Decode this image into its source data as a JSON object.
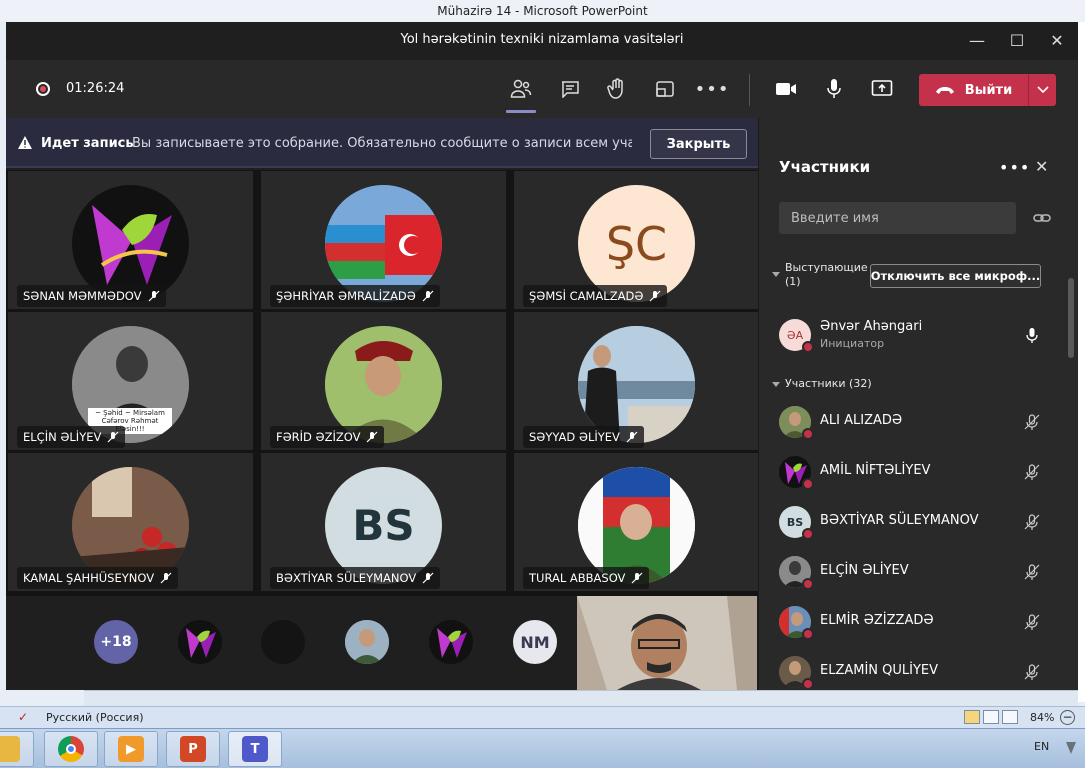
{
  "powerpoint": {
    "title": "Mühazirə 14  -  Microsoft PowerPoint",
    "status_language": "Русский (Россия)",
    "zoom": "84%"
  },
  "taskbar": {
    "language": "EN",
    "apps": [
      "file-explorer-icon",
      "chrome-icon",
      "media-player-icon",
      "powerpoint-icon",
      "teams-icon"
    ]
  },
  "teams": {
    "window_title": "Yol hərəkətinin texniki nizamlama vasitələri",
    "toolbar": {
      "timer": "01:26:24",
      "leave_label": "Выйти"
    },
    "banner": {
      "title": "Идет запись",
      "message": "Вы записываете это собрание. Обязательно сообщите о записи всем участ...",
      "close_label": "Закрыть"
    },
    "tiles": [
      {
        "name": "SƏNAN MƏMMƏDOV",
        "initials": ""
      },
      {
        "name": "ŞƏHRİYAR ƏMRALİZADƏ",
        "initials": ""
      },
      {
        "name": "ŞƏMSİ CAMALZADƏ",
        "initials": "ŞC"
      },
      {
        "name": "ELÇİN ƏLİYEV",
        "initials": "",
        "caption": "~ Şəhid ~ Mirsəlam Cəfərov Rəhmət Eləsin!!!"
      },
      {
        "name": "FƏRİD ƏZİZOV",
        "initials": ""
      },
      {
        "name": "SƏYYAD ƏLİYEV",
        "initials": ""
      },
      {
        "name": "KAMAL ŞAHHÜSEYNOV",
        "initials": ""
      },
      {
        "name": "BƏXTİYAR SÜLEYMANOV",
        "initials": "BS"
      },
      {
        "name": "TURAL ABBASOV",
        "initials": ""
      }
    ],
    "strip": {
      "overflow_count": "+18",
      "initials_bubble": "NM"
    },
    "participants_panel": {
      "title": "Участники",
      "search_placeholder": "Введите имя",
      "presenters_label": "Выступающие (1)",
      "mute_all_label": "Отключить все микроф...",
      "presenter": {
        "name": "Ənvər Ahəngari",
        "role": "Инициатор",
        "initials": "ƏA"
      },
      "attendees_label": "Участники (32)",
      "attendees": [
        {
          "name": "ALI ALIZADƏ",
          "initials": ""
        },
        {
          "name": "AMİL NİFTƏLİYEV",
          "initials": ""
        },
        {
          "name": "BƏXTİYAR SÜLEYMANOV",
          "initials": "BS"
        },
        {
          "name": "ELÇİN ƏLİYEV",
          "initials": ""
        },
        {
          "name": "ELMİR ƏZİZZADƏ",
          "initials": ""
        },
        {
          "name": "ELZAMİN QULİYEV",
          "initials": ""
        }
      ]
    }
  },
  "colors": {
    "leave_red": "#c4314b",
    "accent_purple": "#6264a7",
    "banner_bg": "#2b2b40"
  }
}
